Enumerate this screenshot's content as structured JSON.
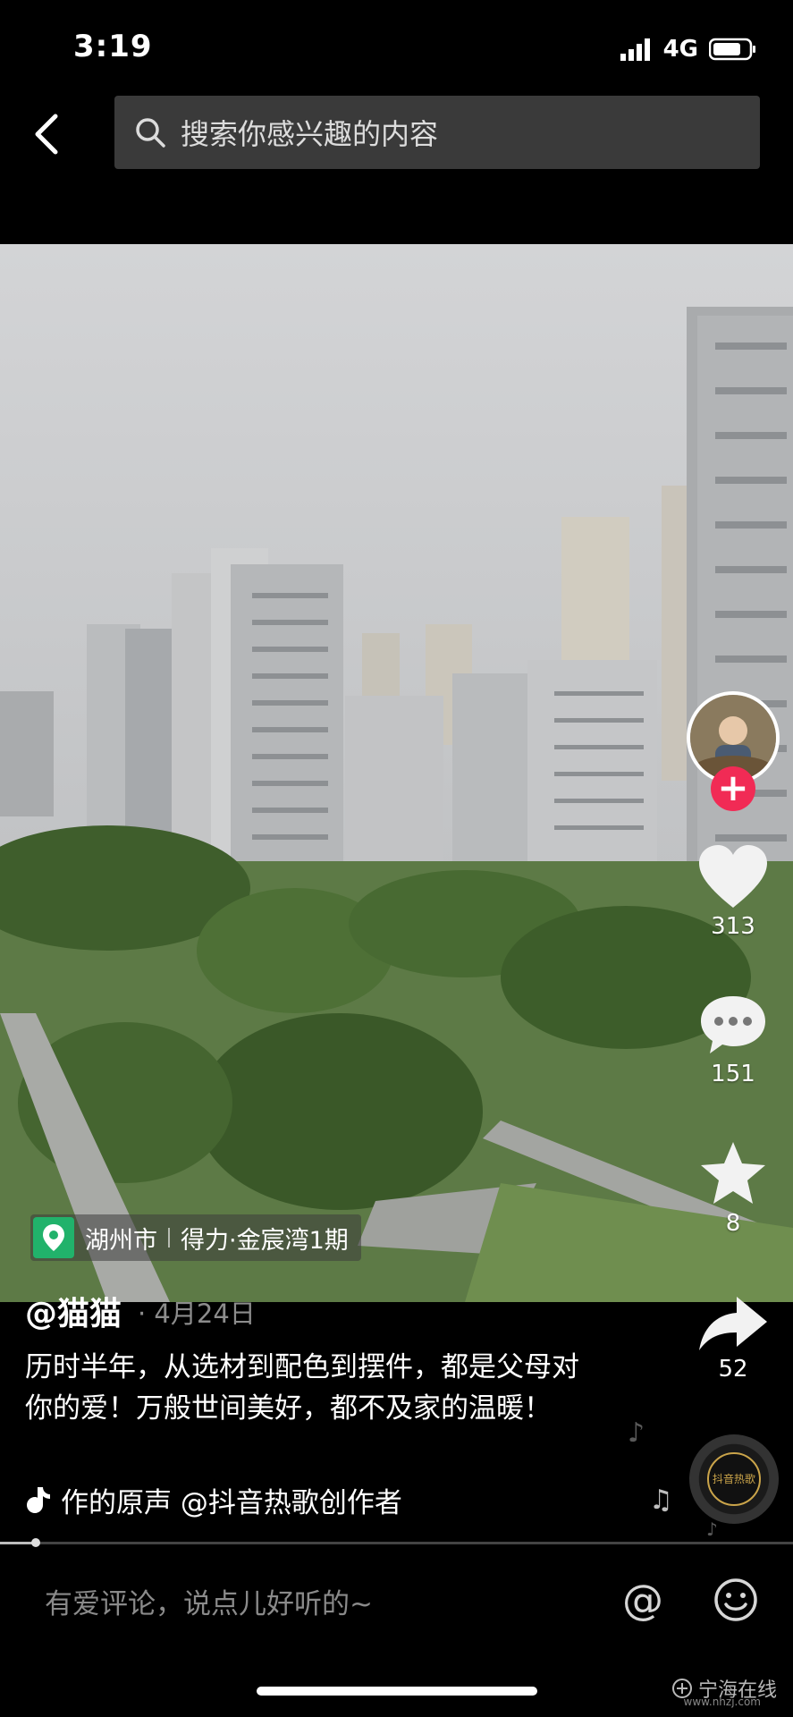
{
  "status_bar": {
    "time": "3:19",
    "network": "4G"
  },
  "search": {
    "placeholder": "搜索你感兴趣的内容"
  },
  "location": {
    "city": "湖州市",
    "place": "得力·金宸湾1期"
  },
  "author": {
    "handle": "@猫猫",
    "date": "· 4月24日"
  },
  "caption": "历时半年，从选材到配色到摆件，都是父母对你的爱！万般世间美好，都不及家的温暖！",
  "music": {
    "text": "作的原声    @抖音热歌创作者"
  },
  "actions": {
    "likes": "313",
    "comments": "151",
    "favorites": "8",
    "shares": "52"
  },
  "record": {
    "label": "抖音热歌"
  },
  "comment_bar": {
    "placeholder": "有爱评论，说点儿好听的~"
  },
  "watermark": {
    "text": "宁海在线",
    "url": "www.nhzj.com"
  },
  "playback": {
    "progress": 0.045
  },
  "colors": {
    "follow_button": "#f12b55",
    "location_pin": "#21b26b",
    "background": "#000000"
  },
  "icons": [
    "back-arrow-icon",
    "search-icon",
    "heart-icon",
    "comment-icon",
    "star-icon",
    "share-icon",
    "music-note-icon",
    "at-icon",
    "emoji-icon",
    "location-pin-icon"
  ]
}
